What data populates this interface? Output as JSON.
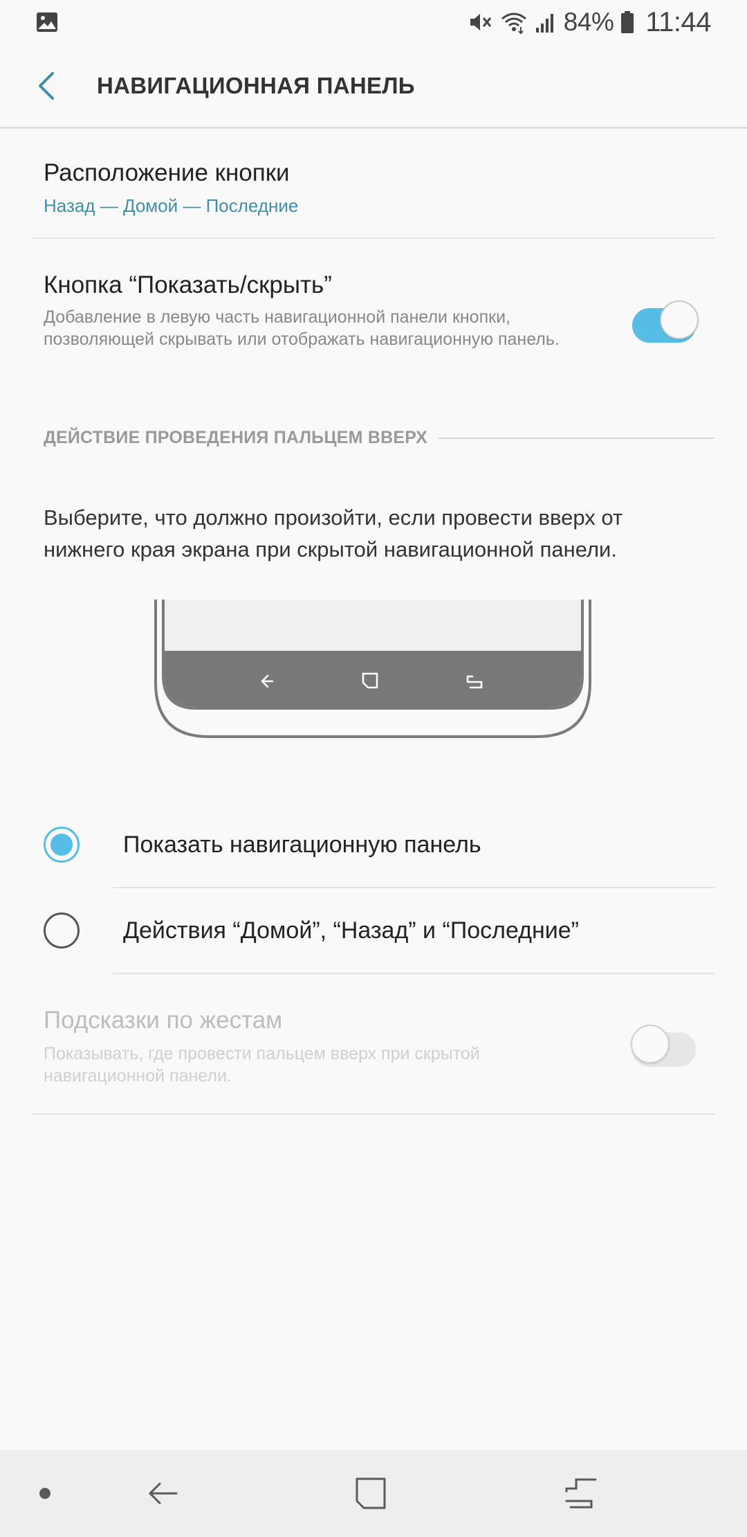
{
  "status_bar": {
    "battery_percent": "84%",
    "time": "11:44",
    "icons": [
      "gallery-icon",
      "mute-icon",
      "wifi-icon",
      "signal-icon",
      "battery-icon"
    ]
  },
  "header": {
    "title": "НАВИГАЦИОННАЯ ПАНЕЛЬ",
    "back_icon": "chevron-left-icon"
  },
  "button_layout": {
    "title": "Расположение кнопки",
    "value": "Назад — Домой — Последние"
  },
  "show_hide_button": {
    "title": "Кнопка “Показать/скрыть”",
    "description": "Добавление в левую часть навигационной панели кнопки, позволяющей скрывать или отображать навигационную панель.",
    "enabled": true
  },
  "swipe_section": {
    "header": "ДЕЙСТВИЕ ПРОВЕДЕНИЯ ПАЛЬЦЕМ ВВЕРХ",
    "description": "Выберите, что должно произойти, если провести вверх от нижнего края экрана при скрытой навигационной панели.",
    "options": [
      {
        "label": "Показать навигационную панель",
        "selected": true
      },
      {
        "label": "Действия “Домой”, “Назад” и “Последние”",
        "selected": false
      }
    ]
  },
  "gesture_hints": {
    "title": "Подсказки по жестам",
    "description": "Показывать, где провести пальцем вверх при скрытой навигационной панели.",
    "enabled": false,
    "disabled": true
  },
  "nav_bar": {
    "buttons": [
      "dot-icon",
      "back-icon",
      "home-icon",
      "recents-icon"
    ]
  },
  "colors": {
    "accent": "#56bde6",
    "subtitle_accent": "#3e8fab",
    "background": "#f9f9f9",
    "nav_bar": "#eeeeee"
  }
}
